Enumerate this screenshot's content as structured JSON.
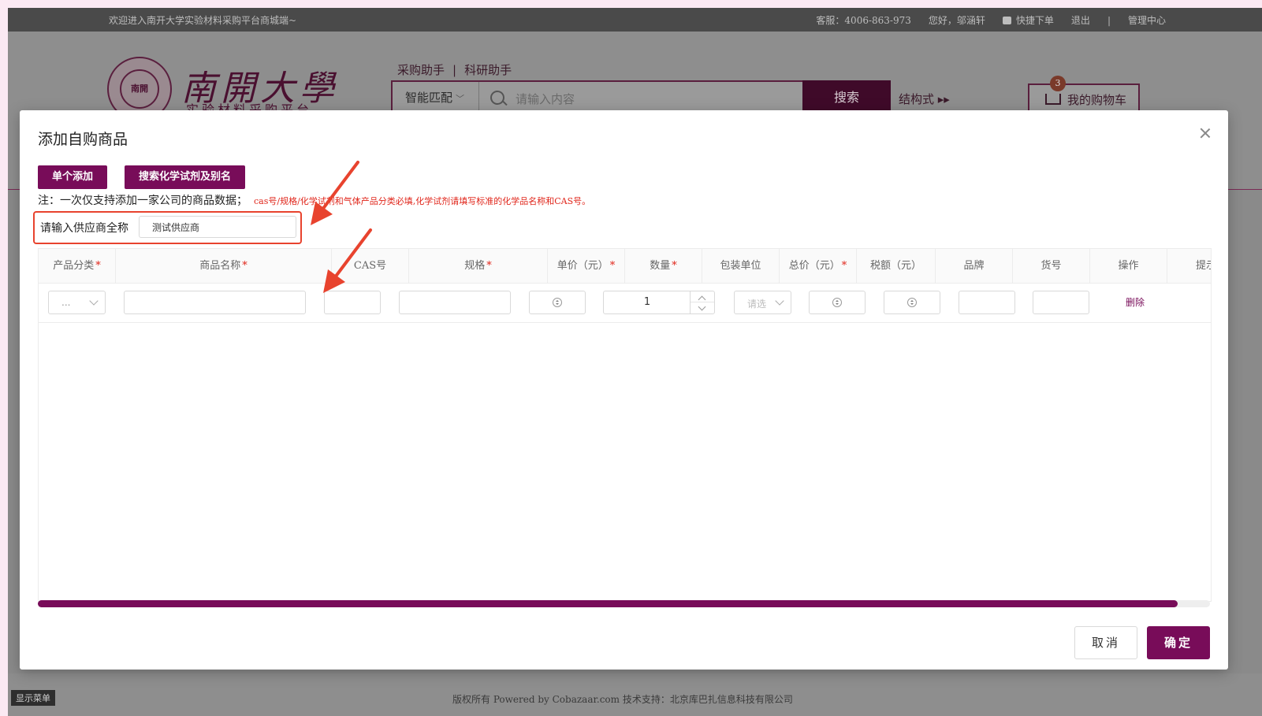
{
  "topbar": {
    "welcome": "欢迎进入南开大学实验材料采购平台商城端~",
    "service": "客服：4006-863-973",
    "greeting": "您好，邬涵轩",
    "quick_order": "快捷下单",
    "logout": "退出",
    "divider": "|",
    "admin_center": "管理中心"
  },
  "header": {
    "logo_seal_text": "南開",
    "logo_name": "南開大學",
    "logo_sub": "实验材料采购平台",
    "helper_purchase": "采购助手",
    "helper_sep": "|",
    "helper_research": "科研助手",
    "search_mode": "智能匹配",
    "search_placeholder": "请输入内容",
    "search_button": "搜索",
    "structure_link": "结构式 ▸▸",
    "cart_label": "我的购物车",
    "cart_count": "3"
  },
  "modal": {
    "title": "添加自购商品",
    "btn_single_add": "单个添加",
    "btn_search_chem": "搜索化学试剂及别名",
    "note_black": "注：一次仅支持添加一家公司的商品数据；",
    "note_red": "cas号/规格/化学试剂和气体产品分类必填,化学试剂请填写标准的化学品名称和CAS号。",
    "supplier_label": "请输入供应商全称",
    "supplier_value": "测试供应商",
    "columns": {
      "category": "产品分类",
      "name": "商品名称",
      "cas": "CAS号",
      "spec": "规格",
      "unit_price": "单价（元）",
      "quantity": "数量",
      "package_unit": "包装单位",
      "total_price": "总价（元）",
      "tax": "税额（元）",
      "brand": "品牌",
      "item_no": "货号",
      "action": "操作",
      "extra": "提示"
    },
    "row": {
      "category_value": "...",
      "quantity_value": "1",
      "package_placeholder": "请选",
      "delete": "删除"
    },
    "btn_cancel": "取消",
    "btn_confirm": "确定"
  },
  "footer": {
    "copyright": "版权所有 Powered by Cobazaar.com 技术支持：北京库巴扎信息科技有限公司",
    "menu_toggle": "显示菜单"
  },
  "colors": {
    "brand": "#780c59",
    "annotation_red": "#e8432e",
    "required_red": "#e0251a"
  }
}
